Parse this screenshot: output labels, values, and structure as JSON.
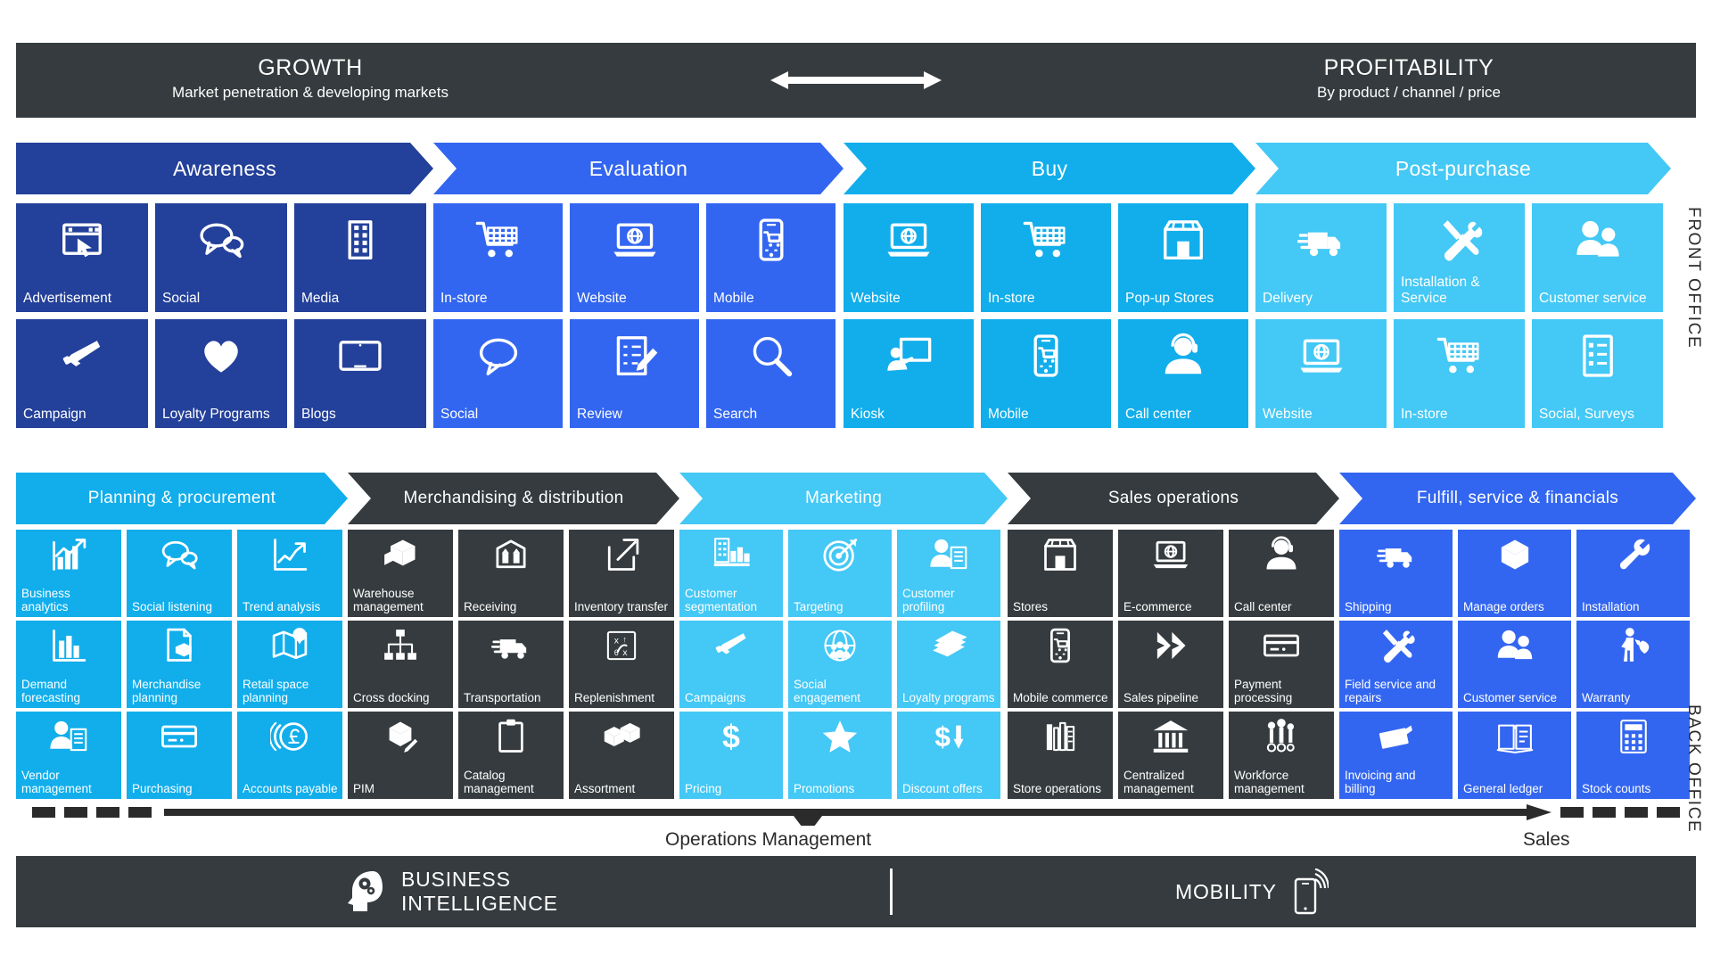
{
  "strategy": {
    "left_title": "GROWTH",
    "left_sub": "Market penetration & developing markets",
    "right_title": "PROFITABILITY",
    "right_sub": "By product / channel / price",
    "arrow_icon": "double-arrow-icon"
  },
  "front_office": {
    "side_label": "FRONT OFFICE",
    "stages": [
      {
        "label": "Awareness",
        "color": "#23409a",
        "tiles": [
          {
            "label": "Advertisement",
            "icon": "browser-click-icon"
          },
          {
            "label": "Social",
            "icon": "speech-bubbles-icon"
          },
          {
            "label": "Media",
            "icon": "film-strip-icon"
          },
          {
            "label": "Campaign",
            "icon": "megaphone-icon"
          },
          {
            "label": "Loyalty Programs",
            "icon": "heart-icon"
          },
          {
            "label": "Blogs",
            "icon": "tablet-icon"
          }
        ]
      },
      {
        "label": "Evaluation",
        "color": "#3366f0",
        "tiles": [
          {
            "label": "In-store",
            "icon": "shopping-cart-icon"
          },
          {
            "label": "Website",
            "icon": "laptop-globe-icon"
          },
          {
            "label": "Mobile",
            "icon": "phone-cart-icon"
          },
          {
            "label": "Social",
            "icon": "speech-bubble-icon"
          },
          {
            "label": "Review",
            "icon": "checklist-pen-icon"
          },
          {
            "label": "Search",
            "icon": "magnifier-icon"
          }
        ]
      },
      {
        "label": "Buy",
        "color": "#11aeeb",
        "tiles": [
          {
            "label": "Website",
            "icon": "laptop-globe-icon"
          },
          {
            "label": "In-store",
            "icon": "shopping-cart-icon"
          },
          {
            "label": "Pop-up Stores",
            "icon": "storefront-icon"
          },
          {
            "label": "Kiosk",
            "icon": "kiosk-person-icon"
          },
          {
            "label": "Mobile",
            "icon": "phone-cart-icon"
          },
          {
            "label": "Call center",
            "icon": "headset-person-icon"
          }
        ]
      },
      {
        "label": "Post-purchase",
        "color": "#44c8f5",
        "tiles": [
          {
            "label": "Delivery",
            "icon": "delivery-truck-icon"
          },
          {
            "label": "Installation & Service",
            "icon": "wrench-screwdriver-icon"
          },
          {
            "label": "Customer service",
            "icon": "two-people-icon"
          },
          {
            "label": "Website",
            "icon": "laptop-globe-icon"
          },
          {
            "label": "In-store",
            "icon": "shopping-cart-icon"
          },
          {
            "label": "Social, Surveys",
            "icon": "checklist-icon"
          }
        ]
      }
    ]
  },
  "back_office": {
    "side_label": "BACK OFFICE",
    "stages": [
      {
        "label": "Planning & procurement",
        "color": "#11aeeb",
        "tiles": [
          {
            "label": "Business analytics",
            "icon": "growth-chart-icon"
          },
          {
            "label": "Social listening",
            "icon": "speech-bubbles-icon"
          },
          {
            "label": "Trend analysis",
            "icon": "trend-line-icon"
          },
          {
            "label": "Demand forecasting",
            "icon": "bar-chart-icon"
          },
          {
            "label": "Merchandise planning",
            "icon": "document-box-icon"
          },
          {
            "label": "Retail space planning",
            "icon": "map-pin-icon"
          },
          {
            "label": "Vendor management",
            "icon": "person-document-icon"
          },
          {
            "label": "Purchasing",
            "icon": "credit-card-icon"
          },
          {
            "label": "Accounts payable",
            "icon": "pound-coin-icon"
          }
        ]
      },
      {
        "label": "Merchandising & distribution",
        "color": "#353b3e",
        "tiles": [
          {
            "label": "Warehouse management",
            "icon": "boxes-icon"
          },
          {
            "label": "Receiving",
            "icon": "box-arrows-up-icon"
          },
          {
            "label": "Inventory transfer",
            "icon": "share-arrow-icon"
          },
          {
            "label": "Cross docking",
            "icon": "hierarchy-icon"
          },
          {
            "label": "Transportation",
            "icon": "delivery-truck-icon"
          },
          {
            "label": "Replenishment",
            "icon": "replenish-grid-icon"
          },
          {
            "label": "PIM",
            "icon": "box-pencil-icon"
          },
          {
            "label": "Catalog management",
            "icon": "clipboard-icon"
          },
          {
            "label": "Assortment",
            "icon": "two-boxes-icon"
          }
        ]
      },
      {
        "label": "Marketing",
        "color": "#44c8f5",
        "tiles": [
          {
            "label": "Customer segmentation",
            "icon": "segmentation-icon"
          },
          {
            "label": "Targeting",
            "icon": "target-dart-icon"
          },
          {
            "label": "Customer profiling",
            "icon": "person-document-icon"
          },
          {
            "label": "Campaigns",
            "icon": "megaphone-icon"
          },
          {
            "label": "Social engagement",
            "icon": "globe-people-icon"
          },
          {
            "label": "Loyalty programs",
            "icon": "cash-stack-icon"
          },
          {
            "label": "Pricing",
            "icon": "dollar-icon"
          },
          {
            "label": "Promotions",
            "icon": "star-icon"
          },
          {
            "label": "Discount offers",
            "icon": "dollar-down-icon"
          }
        ]
      },
      {
        "label": "Sales operations",
        "color": "#353b3e",
        "tiles": [
          {
            "label": "Stores",
            "icon": "storefront-icon"
          },
          {
            "label": "E-commerce",
            "icon": "laptop-globe-icon"
          },
          {
            "label": "Call center",
            "icon": "headset-person-icon"
          },
          {
            "label": "Mobile commerce",
            "icon": "phone-cart-icon"
          },
          {
            "label": "Sales pipeline",
            "icon": "double-chevron-icon"
          },
          {
            "label": "Payment processing",
            "icon": "credit-card-icon"
          },
          {
            "label": "Store operations",
            "icon": "shelf-books-icon"
          },
          {
            "label": "Centralized management",
            "icon": "bank-icon"
          },
          {
            "label": "Workforce management",
            "icon": "workforce-icon"
          }
        ]
      },
      {
        "label": "Fulfill, service & financials",
        "color": "#3366f0",
        "tiles": [
          {
            "label": "Shipping",
            "icon": "delivery-truck-icon"
          },
          {
            "label": "Manage orders",
            "icon": "box-icon"
          },
          {
            "label": "Installation",
            "icon": "wrench-icon"
          },
          {
            "label": "Field service and repairs",
            "icon": "wrench-screwdriver-icon"
          },
          {
            "label": "Customer service",
            "icon": "two-people-icon"
          },
          {
            "label": "Warranty",
            "icon": "person-shield-icon"
          },
          {
            "label": "Invoicing and billing",
            "icon": "invoice-card-icon"
          },
          {
            "label": "General ledger",
            "icon": "open-book-icon"
          },
          {
            "label": "Stock counts",
            "icon": "calculator-icon"
          }
        ]
      }
    ]
  },
  "flow": {
    "ops_label": "Operations Management",
    "sales_label": "Sales"
  },
  "platform": {
    "bi_label_line1": "BUSINESS",
    "bi_label_line2": "INTELLIGENCE",
    "bi_icon": "head-gears-icon",
    "mobility_label": "MOBILITY",
    "mobility_icon": "mobile-signal-icon"
  }
}
